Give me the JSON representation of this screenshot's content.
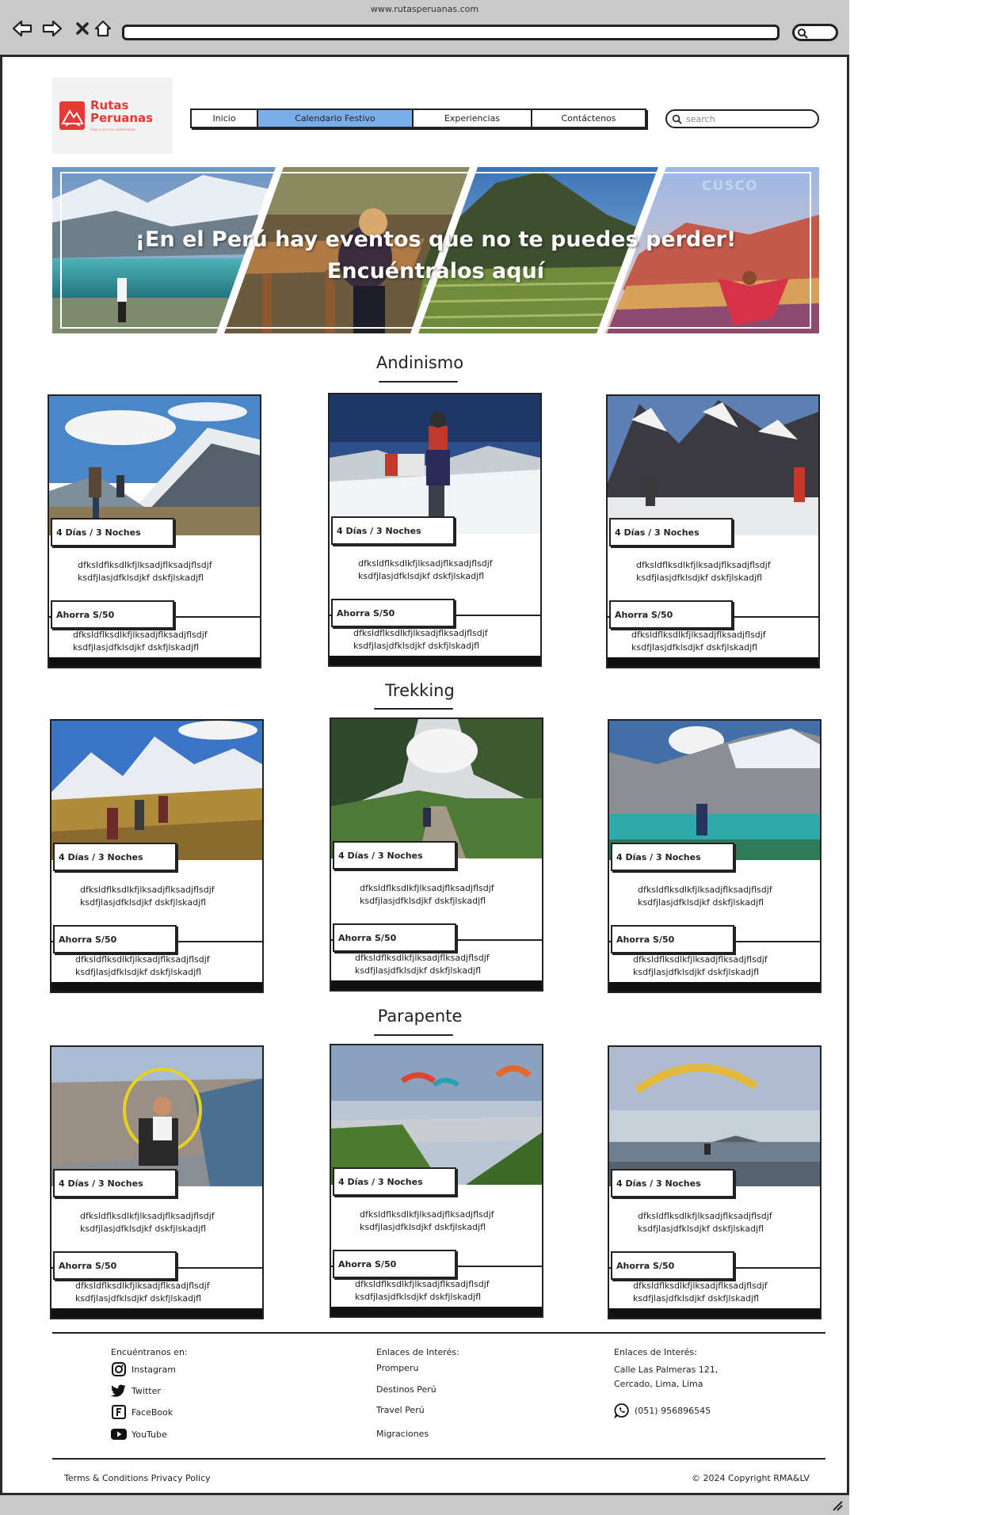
{
  "browser": {
    "url": "www.rutasperuanas.com"
  },
  "logo": {
    "line1": "Rutas",
    "line2": "Peruanas",
    "tagline": "Viaja y vive tus experiencias"
  },
  "nav": {
    "items": [
      "Inicio",
      "Calendario Festivo",
      "Experiencias",
      "Contáctenos"
    ],
    "active": "Calendario Festivo"
  },
  "search": {
    "placeholder": "search"
  },
  "hero": {
    "line1": "¡En el Perú hay eventos que no te puedes perder!",
    "line2": "Encuéntralos aquí",
    "watermark": "CUSCO"
  },
  "sections": [
    {
      "title": "Andinismo",
      "cards": [
        {
          "duration": "4 Días / 3 Noches",
          "desc1": "dfksldflksdlkfjlksadjflksadjflsdjf",
          "desc2": "ksdfjlasjdfklsdjkf dskfjlskadjfl",
          "price": "Ahorra S/50",
          "extra1": "dfksldflksdlkfjlksadjflksadjflsdjf",
          "extra2": "ksdfjlasjdfklsdjkf dskfjlskadjfl"
        },
        {
          "duration": "4 Días / 3 Noches",
          "desc1": "dfksldflksdlkfjlksadjflksadjflsdjf",
          "desc2": "ksdfjlasjdfklsdjkf dskfjlskadjfl",
          "price": "Ahorra S/50",
          "extra1": "dfksldflksdlkfjlksadjflksadjflsdjf",
          "extra2": "ksdfjlasjdfklsdjkf dskfjlskadjfl"
        },
        {
          "duration": "4 Días / 3 Noches",
          "desc1": "dfksldflksdlkfjlksadjflksadjflsdjf",
          "desc2": "ksdfjlasjdfklsdjkf dskfjlskadjfl",
          "price": "Ahorra S/50",
          "extra1": "dfksldflksdlkfjlksadjflksadjflsdjf",
          "extra2": "ksdfjlasjdfklsdjkf dskfjlskadjfl"
        }
      ]
    },
    {
      "title": "Trekking",
      "cards": [
        {
          "duration": "4 Días / 3 Noches",
          "desc1": "dfksldflksdlkfjlksadjflksadjflsdjf",
          "desc2": "ksdfjlasjdfklsdjkf dskfjlskadjfl",
          "price": "Ahorra S/50",
          "extra1": "dfksldflksdlkfjlksadjflksadjflsdjf",
          "extra2": "ksdfjlasjdfklsdjkf dskfjlskadjfl"
        },
        {
          "duration": "4 Días / 3 Noches",
          "desc1": "dfksldflksdlkfjlksadjflksadjflsdjf",
          "desc2": "ksdfjlasjdfklsdjkf dskfjlskadjfl",
          "price": "Ahorra S/50",
          "extra1": "dfksldflksdlkfjlksadjflksadjflsdjf",
          "extra2": "ksdfjlasjdfklsdjkf dskfjlskadjfl"
        },
        {
          "duration": "4 Días / 3 Noches",
          "desc1": "dfksldflksdlkfjlksadjflksadjflsdjf",
          "desc2": "ksdfjlasjdfklsdjkf dskfjlskadjfl",
          "price": "Ahorra S/50",
          "extra1": "dfksldflksdlkfjlksadjflksadjflsdjf",
          "extra2": "ksdfjlasjdfklsdjkf dskfjlskadjfl"
        }
      ]
    },
    {
      "title": "Parapente",
      "cards": [
        {
          "duration": "4 Días / 3 Noches",
          "desc1": "dfksldflksdlkfjlksadjflksadjflsdjf",
          "desc2": "ksdfjlasjdfklsdjkf dskfjlskadjfl",
          "price": "Ahorra S/50",
          "extra1": "dfksldflksdlkfjlksadjflksadjflsdjf",
          "extra2": "ksdfjlasjdfklsdjkf dskfjlskadjfl"
        },
        {
          "duration": "4 Días / 3 Noches",
          "desc1": "dfksldflksdlkfjlksadjflksadjflsdjf",
          "desc2": "ksdfjlasjdfklsdjkf dskfjlskadjfl",
          "price": "Ahorra S/50",
          "extra1": "dfksldflksdlkfjlksadjflksadjflsdjf",
          "extra2": "ksdfjlasjdfklsdjkf dskfjlskadjfl"
        },
        {
          "duration": "4 Días / 3 Noches",
          "desc1": "dfksldflksdlkfjlksadjflksadjflsdjf",
          "desc2": "ksdfjlasjdfklsdjkf dskfjlskadjfl",
          "price": "Ahorra S/50",
          "extra1": "dfksldflksdlkfjlksadjflksadjflsdjf",
          "extra2": "ksdfjlasjdfklsdjkf dskfjlskadjfl"
        }
      ]
    }
  ],
  "footer": {
    "social_heading": "Encuéntranos en:",
    "social": [
      {
        "label": "Instagram",
        "icon": "instagram-icon"
      },
      {
        "label": "Twitter",
        "icon": "twitter-icon"
      },
      {
        "label": "FaceBook",
        "icon": "facebook-icon"
      },
      {
        "label": "YouTube",
        "icon": "youtube-icon"
      }
    ],
    "links_heading": "Enlaces de Interés:",
    "links": [
      "Promperu",
      "Destinos Perú",
      "Travel Perú",
      "Migraciones"
    ],
    "contact_heading": "Enlaces de Interés:",
    "address1": "Calle Las Palmeras 121,",
    "address2": "Cercado, Lima, Lima",
    "phone": "(051) 956896545",
    "terms": "Terms & Conditions Privacy Policy",
    "copyright": "© 2024 Copyright RMA&LV"
  }
}
